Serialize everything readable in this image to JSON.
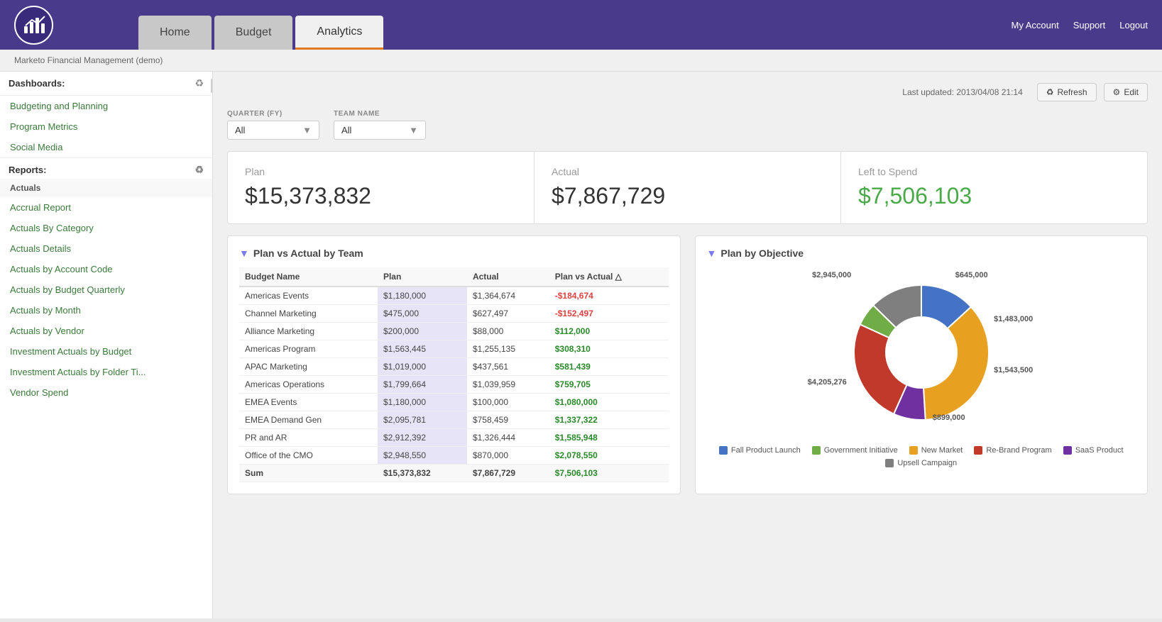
{
  "header": {
    "nav": [
      {
        "label": "Home",
        "active": false
      },
      {
        "label": "Budget",
        "active": false
      },
      {
        "label": "Analytics",
        "active": true
      }
    ],
    "right_links": [
      "My Account",
      "Support",
      "Logout"
    ]
  },
  "breadcrumb": "Marketo Financial Management (demo)",
  "last_updated": "Last updated: 2013/04/08 21:14",
  "buttons": {
    "refresh": "Refresh",
    "edit": "Edit"
  },
  "sidebar": {
    "dashboards_label": "Dashboards:",
    "reports_label": "Reports:",
    "dashboard_items": [
      "Budgeting and Planning",
      "Program Metrics",
      "Social Media"
    ],
    "actuals_label": "Actuals",
    "report_items": [
      "Accrual Report",
      "Actuals By Category",
      "Actuals Details",
      "Actuals by Account Code",
      "Actuals by Budget Quarterly",
      "Actuals by Month",
      "Actuals by Vendor",
      "Investment Actuals by Budget",
      "Investment Actuals by Folder Ti...",
      "Vendor Spend"
    ]
  },
  "filters": {
    "quarter_label": "QUARTER (FY)",
    "quarter_value": "All",
    "team_label": "TEAM NAME",
    "team_value": "All"
  },
  "kpis": {
    "plan_label": "Plan",
    "plan_value": "$15,373,832",
    "actual_label": "Actual",
    "actual_value": "$7,867,729",
    "left_label": "Left to Spend",
    "left_value": "$7,506,103"
  },
  "plan_vs_actual": {
    "title": "Plan vs Actual by Team",
    "columns": [
      "Budget Name",
      "Plan",
      "Actual",
      "Plan vs Actual"
    ],
    "rows": [
      {
        "name": "Americas Events",
        "plan": "$1,180,000",
        "actual": "$1,364,674",
        "pva": "-$184,674",
        "negative": true
      },
      {
        "name": "Channel Marketing",
        "plan": "$475,000",
        "actual": "$627,497",
        "pva": "-$152,497",
        "negative": true
      },
      {
        "name": "Alliance Marketing",
        "plan": "$200,000",
        "actual": "$88,000",
        "pva": "$112,000",
        "negative": false
      },
      {
        "name": "Americas Program",
        "plan": "$1,563,445",
        "actual": "$1,255,135",
        "pva": "$308,310",
        "negative": false
      },
      {
        "name": "APAC Marketing",
        "plan": "$1,019,000",
        "actual": "$437,561",
        "pva": "$581,439",
        "negative": false
      },
      {
        "name": "Americas Operations",
        "plan": "$1,799,664",
        "actual": "$1,039,959",
        "pva": "$759,705",
        "negative": false
      },
      {
        "name": "EMEA Events",
        "plan": "$1,180,000",
        "actual": "$100,000",
        "pva": "$1,080,000",
        "negative": false
      },
      {
        "name": "EMEA Demand Gen",
        "plan": "$2,095,781",
        "actual": "$758,459",
        "pva": "$1,337,322",
        "negative": false
      },
      {
        "name": "PR and AR",
        "plan": "$2,912,392",
        "actual": "$1,326,444",
        "pva": "$1,585,948",
        "negative": false
      },
      {
        "name": "Office of the CMO",
        "plan": "$2,948,550",
        "actual": "$870,000",
        "pva": "$2,078,550",
        "negative": false
      }
    ],
    "sum_row": {
      "name": "Sum",
      "plan": "$15,373,832",
      "actual": "$7,867,729",
      "pva": "$7,506,103"
    }
  },
  "plan_by_objective": {
    "title": "Plan by Objective",
    "segments": [
      {
        "label": "Fall Product Launch",
        "color": "#4472c4",
        "value": 1543500,
        "display": "$1,543,500",
        "angle_start": 0,
        "angle_end": 36
      },
      {
        "label": "New Market",
        "color": "#e8a020",
        "value": 4205276,
        "display": "$4,205,276",
        "angle_start": 36,
        "angle_end": 134
      },
      {
        "label": "SaaS Product",
        "color": "#7030a0",
        "value": 899000,
        "display": "$899,000",
        "angle_start": 134,
        "angle_end": 155
      },
      {
        "label": "Re-Brand Program",
        "color": "#c0392b",
        "value": 2945000,
        "display": "$2,945,000",
        "angle_start": 155,
        "angle_end": 223
      },
      {
        "label": "Government Initiative",
        "color": "#70ad47",
        "value": 645000,
        "display": "$645,000",
        "angle_start": 223,
        "angle_end": 238
      },
      {
        "label": "Upsell Campaign",
        "color": "#7f7f7f",
        "value": 1483000,
        "display": "$1,483,000",
        "angle_start": 238,
        "angle_end": 273
      }
    ],
    "legend": [
      {
        "label": "Fall Product Launch",
        "color": "#4472c4"
      },
      {
        "label": "Government Initiative",
        "color": "#70ad47"
      },
      {
        "label": "New Market",
        "color": "#e8a020"
      },
      {
        "label": "Re-Brand Program",
        "color": "#c0392b"
      },
      {
        "label": "SaaS Product",
        "color": "#7030a0"
      },
      {
        "label": "Upsell Campaign",
        "color": "#7f7f7f"
      }
    ],
    "outer_labels": [
      {
        "text": "$2,945,000",
        "x": "30%",
        "y": "2%"
      },
      {
        "text": "$645,000",
        "x": "68%",
        "y": "2%"
      },
      {
        "text": "$1,483,000",
        "x": "88%",
        "y": "30%"
      },
      {
        "text": "$1,543,500",
        "x": "88%",
        "y": "58%"
      },
      {
        "text": "$899,000",
        "x": "60%",
        "y": "88%"
      },
      {
        "text": "$4,205,276",
        "x": "2%",
        "y": "68%"
      }
    ]
  }
}
